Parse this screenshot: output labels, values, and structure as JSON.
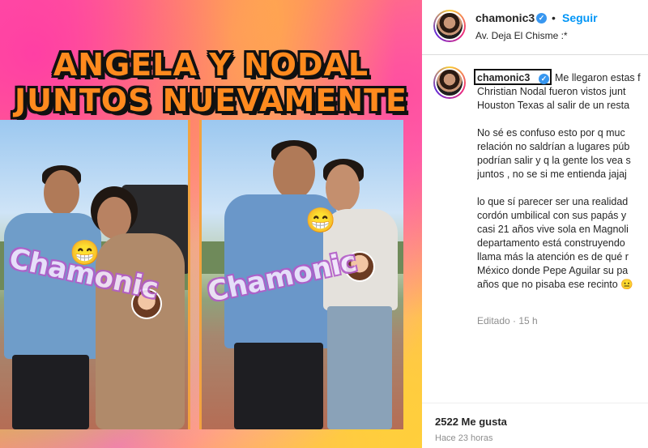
{
  "media": {
    "headline_line1": "ANGELA Y NODAL",
    "headline_line2": "JUNTOS NUEVAMENTE",
    "watermark_left": "Chamonic",
    "watermark_right": "Chamonic",
    "emoji_left": "😁",
    "emoji_right": "😁"
  },
  "header": {
    "username": "chamonic3",
    "verified_icon": "verified-badge-icon",
    "separator": "•",
    "follow_label": "Seguir",
    "subtitle": "Av. Deja El Chisme :*"
  },
  "post": {
    "author": "chamonic3",
    "caption_lines": [
      "Me llegaron estas f",
      "Christian Nodal fueron vistos junt",
      "Houston Texas al salir de un resta",
      "",
      "No sé es confuso esto por q muc",
      "relación no saldrían a lugares púb",
      "podrían salir y q la gente los vea s",
      "juntos , no se si me entienda jajaj",
      "",
      "lo que sí parecer ser una realidad",
      "cordón umbilical con sus papás y",
      "casi 21 años vive sola en Magnoli",
      "departamento está construyendo",
      "llama más la atención es de qué r",
      "México donde Pepe Aguilar su pa",
      "años que no pisaba ese recinto 😐"
    ],
    "edited_label": "Editado · 15 h"
  },
  "footer": {
    "likes": "2522 Me gusta",
    "time_ago": "Hace 23 horas"
  },
  "colors": {
    "accent_blue": "#0095f6",
    "headline_orange": "#ff8a1e",
    "text_dark": "#262626",
    "text_muted": "#8e8e8e"
  }
}
